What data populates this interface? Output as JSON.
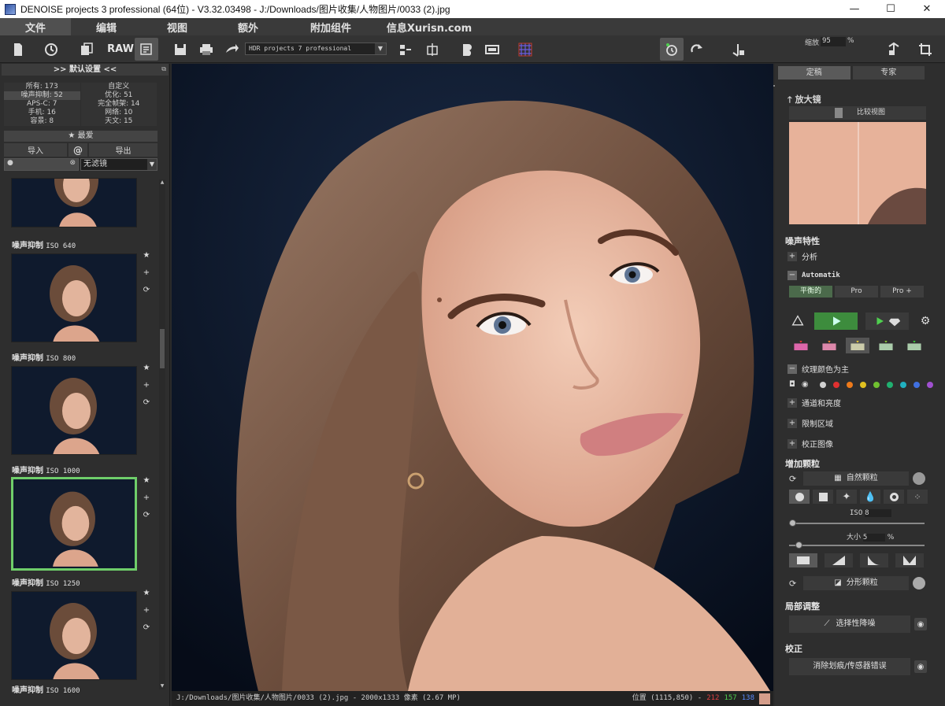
{
  "window": {
    "title": "DENOISE projects 3 professional (64位) - V3.32.03498 - J:/Downloads/图片收集/人物图片/0033 (2).jpg",
    "minimize": "—",
    "maximize": "☐",
    "close": "✕"
  },
  "menu": {
    "items": [
      "文件",
      "编辑",
      "视图",
      "额外",
      "附加组件",
      "信息Xurisn.com"
    ]
  },
  "toolbar": {
    "raw_label": "RAW",
    "preset_value": "HDR projects 7 professional",
    "zoom_label": "缩放",
    "zoom_value": "95",
    "zoom_unit": "%",
    "zoom_level": 0.07
  },
  "left_panel": {
    "header": ">> 默认设置 <<",
    "stats": [
      [
        {
          "label": "所有: 173",
          "sel": false
        },
        {
          "label": "自定义",
          "sel": false
        }
      ],
      [
        {
          "label": "噪声抑制: 52",
          "sel": true
        },
        {
          "label": "优化: 51",
          "sel": false
        }
      ],
      [
        {
          "label": "APS-C: 7",
          "sel": false
        },
        {
          "label": "完全帧架: 14",
          "sel": false
        }
      ],
      [
        {
          "label": "手机: 16",
          "sel": false
        },
        {
          "label": "网络: 10",
          "sel": false
        }
      ],
      [
        {
          "label": "容景: 8",
          "sel": false
        },
        {
          "label": "天文: 15",
          "sel": false
        }
      ]
    ],
    "favorites": "★ 最爱",
    "import_label": "导入",
    "at_label": "@",
    "export_label": "导出",
    "filter_value": "无滤镜",
    "presets": [
      {
        "label": "噪声抑制",
        "iso": "ISO 640",
        "selected": false
      },
      {
        "label": "噪声抑制",
        "iso": "ISO 800",
        "selected": false
      },
      {
        "label": "噪声抑制",
        "iso": "ISO 1000",
        "selected": true
      },
      {
        "label": "噪声抑制",
        "iso": "ISO 1250",
        "selected": false
      },
      {
        "label": "噪声抑制",
        "iso": "ISO 1600",
        "selected": false
      }
    ]
  },
  "status": {
    "file_info": "J:/Downloads/图片收集/人物图片/0033 (2).jpg - 2000x1333 像素 (2.67 MP)",
    "position_label": "位置 (1115,850) -",
    "r": "212",
    "g": "157",
    "b": "138",
    "r_color": "#e04040",
    "g_color": "#4fcf4f",
    "b_color": "#5a8cff",
    "swatch_color": "#d49d8a"
  },
  "right_panel": {
    "tab_standard": "定稿",
    "tab_expert": "专家",
    "magnifier_title": "放大镜",
    "compare_label": "比较视图",
    "noise_title": "噪声特性",
    "analysis": "分析",
    "automatik": "Automatik",
    "mode_buttons": [
      "平衡的",
      "Pro",
      "Pro +"
    ],
    "texture_color": "纹理颜色为主",
    "channels": "通道和亮度",
    "limit_area": "限制区域",
    "correct_image": "校正图像",
    "add_grain_title": "增加颗粒",
    "grain_type": "自然颗粒",
    "iso_label": "ISO",
    "iso_value": "8",
    "size_label": "大小",
    "size_value": "5",
    "size_unit": "%",
    "fractal_grain": "分形颗粒",
    "local_adjust_title": "局部调整",
    "selective_denoise": "选择性降噪",
    "correction_title": "校正",
    "remove_scratches": "消除划痕/传感器错误",
    "colors": [
      "#d0d0d0",
      "#e03030",
      "#ee7a1a",
      "#e0c020",
      "#70c030",
      "#20b070",
      "#20b0c0",
      "#4070e0",
      "#a050d0"
    ]
  }
}
